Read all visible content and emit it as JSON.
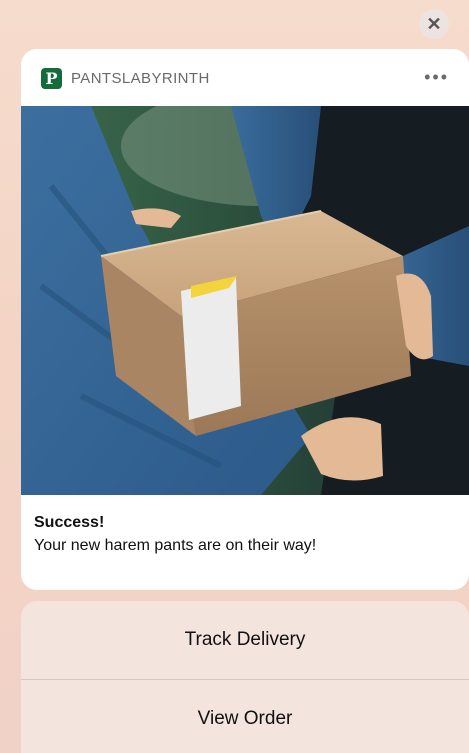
{
  "notification": {
    "app_icon_letter": "P",
    "app_name": "PANTSLABYRINTH",
    "more_label": "•••",
    "close_glyph": "✕",
    "title": "Success!",
    "message": "Your new harem pants are on their way!"
  },
  "actions": [
    {
      "label": "Track Delivery"
    },
    {
      "label": "View Order"
    }
  ],
  "colors": {
    "brand": "#156b3a",
    "background": "#f6dccd",
    "action_panel": "#f3e5dd"
  }
}
